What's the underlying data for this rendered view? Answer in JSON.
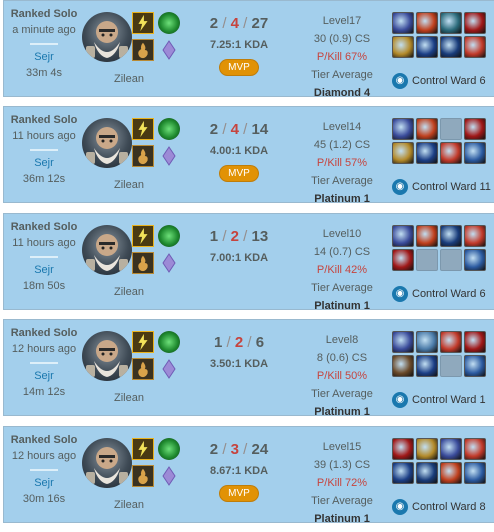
{
  "matches": [
    {
      "queue": "Ranked Solo",
      "ago": "a minute ago",
      "result": "Sejr",
      "duration": "33m 4s",
      "champion": "Zilean",
      "k": "2",
      "d": "4",
      "a": "27",
      "kda": "7.25:1 KDA",
      "mvp": "MVP",
      "level": "Level17",
      "cs": "30 (0.9) CS",
      "pkill": "P/Kill 67%",
      "tier_label": "Tier Average",
      "tier": "Diamond 4",
      "ward": "Control Ward 6",
      "items": [
        "#3a4b9a",
        "#c0401e",
        "#2b6a7a",
        "#a01818",
        "#b38a2a",
        "#1c3f86",
        "#193c7a",
        "#c23a2a"
      ]
    },
    {
      "queue": "Ranked Solo",
      "ago": "11 hours ago",
      "result": "Sejr",
      "duration": "36m 12s",
      "champion": "Zilean",
      "k": "2",
      "d": "4",
      "a": "14",
      "kda": "4.00:1 KDA",
      "mvp": "MVP",
      "level": "Level14",
      "cs": "45 (1.2) CS",
      "pkill": "P/Kill 57%",
      "tier_label": "Tier Average",
      "tier": "Platinum 1",
      "ward": "Control Ward 11",
      "items": [
        "#3a4b9a",
        "#c0401e",
        "empty",
        "#a01818",
        "#b38a2a",
        "#1c3f86",
        "#c23a2a",
        "#2b5aa0"
      ]
    },
    {
      "queue": "Ranked Solo",
      "ago": "11 hours ago",
      "result": "Sejr",
      "duration": "18m 50s",
      "champion": "Zilean",
      "k": "1",
      "d": "2",
      "a": "13",
      "kda": "7.00:1 KDA",
      "mvp": "",
      "level": "Level10",
      "cs": "14 (0.7) CS",
      "pkill": "P/Kill 42%",
      "tier_label": "Tier Average",
      "tier": "Platinum 1",
      "ward": "Control Ward 6",
      "items": [
        "#3a4b9a",
        "#c0401e",
        "#193c7a",
        "#c23a2a",
        "#a01818",
        "empty",
        "empty",
        "#2b5aa0"
      ]
    },
    {
      "queue": "Ranked Solo",
      "ago": "12 hours ago",
      "result": "Sejr",
      "duration": "14m 12s",
      "champion": "Zilean",
      "k": "1",
      "d": "2",
      "a": "6",
      "kda": "3.50:1 KDA",
      "mvp": "",
      "level": "Level8",
      "cs": "8 (0.6) CS",
      "pkill": "P/Kill 50%",
      "tier_label": "Tier Average",
      "tier": "Platinum 1",
      "ward": "Control Ward 1",
      "items": [
        "#3a4b9a",
        "#4a7aa8",
        "#c23a2a",
        "#a01818",
        "#6a4a2a",
        "#1c3f86",
        "empty",
        "#2b5aa0"
      ]
    },
    {
      "queue": "Ranked Solo",
      "ago": "12 hours ago",
      "result": "Sejr",
      "duration": "30m 16s",
      "champion": "Zilean",
      "k": "2",
      "d": "3",
      "a": "24",
      "kda": "8.67:1 KDA",
      "mvp": "MVP",
      "level": "Level15",
      "cs": "39 (1.3) CS",
      "pkill": "P/Kill 72%",
      "tier_label": "Tier Average",
      "tier": "Platinum 1",
      "ward": "Control Ward 8",
      "items": [
        "#a01818",
        "#b38a2a",
        "#3a4b9a",
        "#c23a2a",
        "#1c3f86",
        "#193c7a",
        "#c0401e",
        "#2b5aa0"
      ]
    }
  ]
}
